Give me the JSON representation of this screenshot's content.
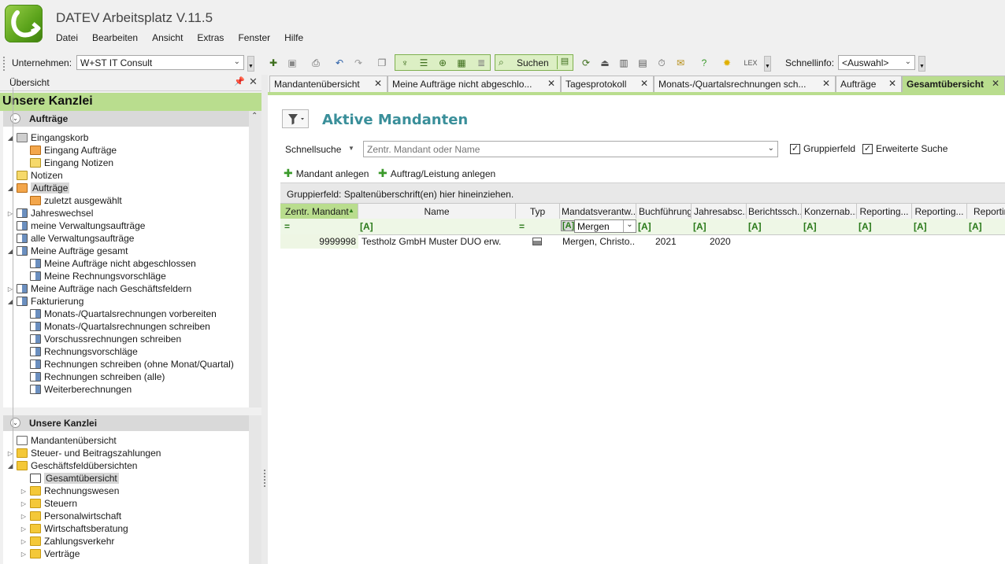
{
  "app": {
    "title": "DATEV Arbeitsplatz V.11.5"
  },
  "menu": [
    "Datei",
    "Bearbeiten",
    "Ansicht",
    "Extras",
    "Fenster",
    "Hilfe"
  ],
  "toolbar": {
    "company_label": "Unternehmen:",
    "company_value": "W+ST IT Consult",
    "search_label": "Suchen",
    "quickinfo_label": "Schnellinfo:",
    "quickinfo_value": "<Auswahl>"
  },
  "left_panel": {
    "header": "Übersicht",
    "banner": "Unsere Kanzlei",
    "section1": {
      "title": "Aufträge",
      "items": [
        {
          "label": "Eingangskorb",
          "level": 0,
          "expander": "◢",
          "icon": "tray"
        },
        {
          "label": "Eingang Aufträge",
          "level": 1,
          "expander": "",
          "icon": "hand"
        },
        {
          "label": "Eingang Notizen",
          "level": 1,
          "expander": "",
          "icon": "note"
        },
        {
          "label": "Notizen",
          "level": 0,
          "expander": "",
          "icon": "note"
        },
        {
          "label": "Aufträge",
          "level": 0,
          "expander": "◢",
          "icon": "hand",
          "selected": true
        },
        {
          "label": "zuletzt ausgewählt",
          "level": 1,
          "expander": "",
          "icon": "hand"
        },
        {
          "label": "Jahreswechsel",
          "level": 0,
          "expander": "▷",
          "icon": "report"
        },
        {
          "label": "meine Verwaltungsaufträge",
          "level": 0,
          "expander": "",
          "icon": "report"
        },
        {
          "label": "alle Verwaltungsaufträge",
          "level": 0,
          "expander": "",
          "icon": "report"
        },
        {
          "label": "Meine Aufträge gesamt",
          "level": 0,
          "expander": "◢",
          "icon": "report"
        },
        {
          "label": "Meine Aufträge nicht abgeschlossen",
          "level": 1,
          "expander": "",
          "icon": "report"
        },
        {
          "label": "Meine Rechnungsvorschläge",
          "level": 1,
          "expander": "",
          "icon": "report"
        },
        {
          "label": "Meine Aufträge nach Geschäftsfeldern",
          "level": 0,
          "expander": "▷",
          "icon": "report"
        },
        {
          "label": "Fakturierung",
          "level": 0,
          "expander": "◢",
          "icon": "report"
        },
        {
          "label": "Monats-/Quartalsrechnungen vorbereiten",
          "level": 1,
          "expander": "",
          "icon": "report"
        },
        {
          "label": "Monats-/Quartalsrechnungen schreiben",
          "level": 1,
          "expander": "",
          "icon": "report"
        },
        {
          "label": "Vorschussrechnungen schreiben",
          "level": 1,
          "expander": "",
          "icon": "report"
        },
        {
          "label": "Rechnungsvorschläge",
          "level": 1,
          "expander": "",
          "icon": "report"
        },
        {
          "label": "Rechnungen schreiben (ohne Monat/Quartal)",
          "level": 1,
          "expander": "",
          "icon": "report"
        },
        {
          "label": "Rechnungen schreiben (alle)",
          "level": 1,
          "expander": "",
          "icon": "report"
        },
        {
          "label": "Weiterberechnungen",
          "level": 1,
          "expander": "",
          "icon": "report"
        }
      ]
    },
    "section2": {
      "title": "Unsere Kanzlei",
      "items": [
        {
          "label": "Mandantenübersicht",
          "level": 0,
          "expander": "",
          "icon": "doc"
        },
        {
          "label": "Steuer- und Beitragszahlungen",
          "level": 0,
          "expander": "▷",
          "icon": "folder"
        },
        {
          "label": "Geschäftsfeldübersichten",
          "level": 0,
          "expander": "◢",
          "icon": "folder"
        },
        {
          "label": "Gesamtübersicht",
          "level": 1,
          "expander": "",
          "icon": "sheet",
          "selected": true
        },
        {
          "label": "Rechnungswesen",
          "level": 1,
          "expander": "▷",
          "icon": "folder"
        },
        {
          "label": "Steuern",
          "level": 1,
          "expander": "▷",
          "icon": "folder"
        },
        {
          "label": "Personalwirtschaft",
          "level": 1,
          "expander": "▷",
          "icon": "folder"
        },
        {
          "label": "Wirtschaftsberatung",
          "level": 1,
          "expander": "▷",
          "icon": "folder"
        },
        {
          "label": "Zahlungsverkehr",
          "level": 1,
          "expander": "▷",
          "icon": "folder"
        },
        {
          "label": "Verträge",
          "level": 1,
          "expander": "▷",
          "icon": "folder"
        }
      ]
    }
  },
  "tabs": [
    {
      "label": "Mandantenübersicht",
      "active": false
    },
    {
      "label": "Meine Aufträge nicht abgeschlo...",
      "active": false
    },
    {
      "label": "Tagesprotokoll",
      "active": false
    },
    {
      "label": "Monats-/Quartalsrechnungen sch...",
      "active": false
    },
    {
      "label": "Aufträge",
      "active": false
    },
    {
      "label": "Gesamtübersicht",
      "active": true
    }
  ],
  "content": {
    "title": "Aktive Mandanten",
    "quick_search_label": "Schnellsuche",
    "search_placeholder": "Zentr. Mandant oder Name",
    "check_group": "Gruppierfeld",
    "check_extended": "Erweiterte Suche",
    "action_add_client": "Mandant anlegen",
    "action_add_order": "Auftrag/Leistung anlegen",
    "group_hint": "Gruppierfeld: Spaltenüberschrift(en) hier hineinziehen.",
    "columns": [
      "Zentr. Mandant",
      "Name",
      "Typ",
      "Mandatsverantw...",
      "Buchführung",
      "Jahresabsc...",
      "Berichtssch...",
      "Konzernab...",
      "Reporting...",
      "Reporting...",
      "Reportin"
    ],
    "filter": {
      "equals_sign": "=",
      "text_marker": "[A]",
      "mandate_value": "Mergen"
    },
    "row": {
      "client_no": "9999998",
      "name": "Testholz GmbH Muster DUO erw.",
      "responsible": "Mergen, Christo...",
      "bookkeeping": "2021",
      "annual": "2020"
    }
  }
}
